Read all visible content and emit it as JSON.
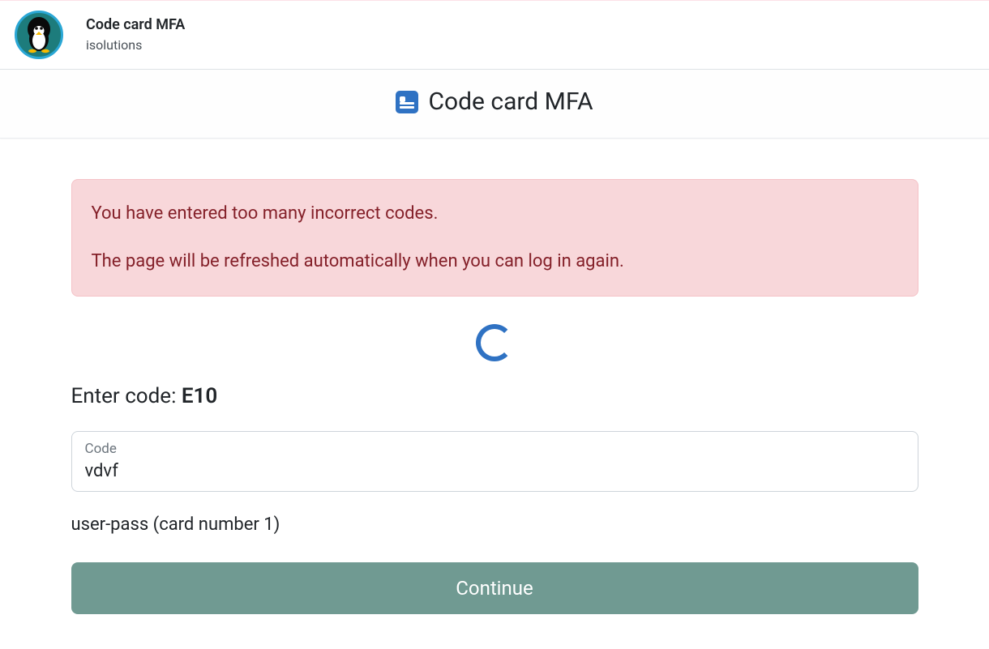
{
  "header": {
    "title": "Code card MFA",
    "subtitle": "isolutions"
  },
  "page": {
    "title": "Code card MFA"
  },
  "alert": {
    "line1": "You have entered too many incorrect codes.",
    "line2": "The page will be refreshed automatically when you can log in again."
  },
  "form": {
    "prompt_prefix": "Enter code: ",
    "code_ref": "E10",
    "input_label": "Code",
    "input_value": "vdvf",
    "helper": "user-pass (card number 1)",
    "submit_label": "Continue"
  }
}
